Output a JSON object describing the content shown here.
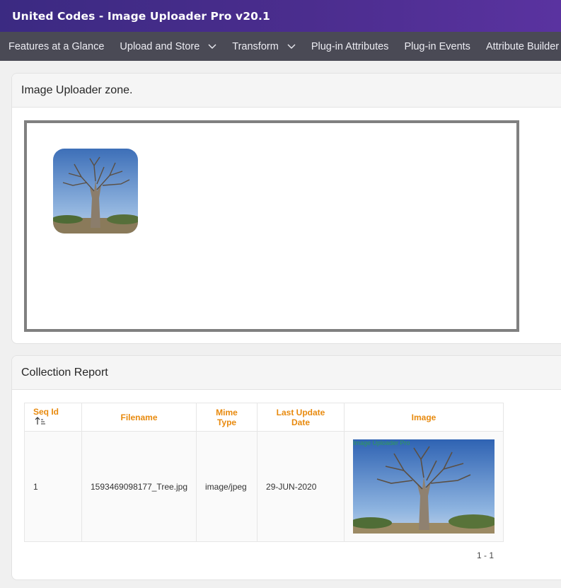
{
  "header": {
    "title": "United Codes - Image Uploader Pro v20.1"
  },
  "nav": {
    "items": [
      {
        "label": "Features at a Glance",
        "has_menu": false
      },
      {
        "label": "Upload and Store",
        "has_menu": true
      },
      {
        "label": "Transform",
        "has_menu": true
      },
      {
        "label": "Plug-in Attributes",
        "has_menu": false
      },
      {
        "label": "Plug-in Events",
        "has_menu": false
      },
      {
        "label": "Attribute Builder",
        "has_menu": false
      }
    ]
  },
  "uploader": {
    "title": "Image Uploader zone.",
    "thumbnail": "baobab-tree-photo"
  },
  "report": {
    "title": "Collection Report",
    "columns": [
      "Seq Id",
      "Filename",
      "Mime Type",
      "Last Update Date",
      "Image"
    ],
    "rows": [
      {
        "seq_id": "1",
        "filename": "1593469098177_Tree.jpg",
        "mime_type": "image/jpeg",
        "last_update": "29-JUN-2020",
        "image": "baobab-tree-photo"
      }
    ],
    "watermark": "Image Uploader Pro",
    "pagination": "1 - 1"
  },
  "colors": {
    "header_start": "#3b2a82",
    "header_end": "#5a33a0",
    "nav_bg": "#4a4a55",
    "column_header": "#e88a0e",
    "drop_border": "#808080"
  }
}
